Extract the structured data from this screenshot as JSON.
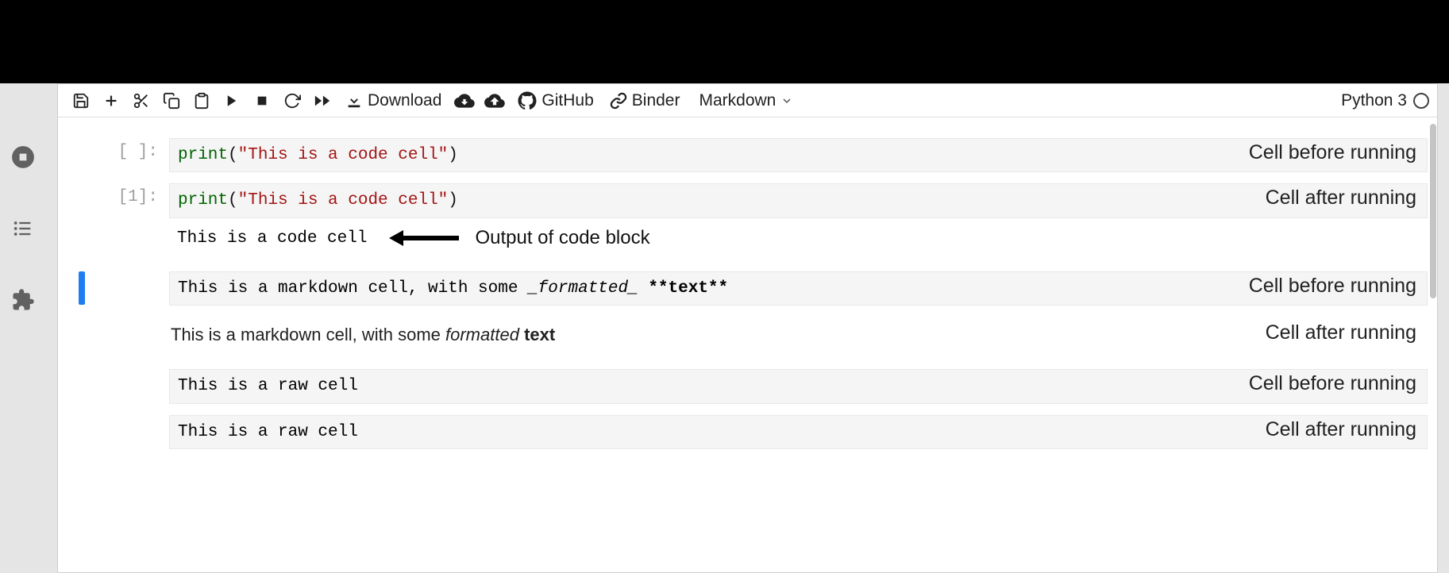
{
  "toolbar": {
    "download_label": "Download",
    "github_label": "GitHub",
    "binder_label": "Binder",
    "celltype_label": "Markdown"
  },
  "kernel": {
    "name": "Python 3"
  },
  "cells": {
    "c1": {
      "prompt": "[ ]:",
      "code_fn": "print",
      "code_open": "(",
      "code_str": "\"This is a code cell\"",
      "code_close": ")",
      "annotation": "Cell before running"
    },
    "c2": {
      "prompt": "[1]:",
      "code_fn": "print",
      "code_open": "(",
      "code_str": "\"This is a code cell\"",
      "code_close": ")",
      "annotation": "Cell after running",
      "output": "This is a code cell",
      "output_label": "Output of code block"
    },
    "c3": {
      "raw_pre": "This is a markdown cell, with some ",
      "raw_italic": "_formatted_",
      "raw_mid": " ",
      "raw_bold": "**text**",
      "annotation": "Cell before running"
    },
    "c4": {
      "rendered_pre": "This is a markdown cell, with some ",
      "rendered_italic": "formatted",
      "rendered_mid": " ",
      "rendered_bold": "text",
      "annotation": "Cell after running"
    },
    "c5": {
      "text": "This is a raw cell",
      "annotation": "Cell before running"
    },
    "c6": {
      "text": "This is a raw cell",
      "annotation": "Cell after running"
    }
  }
}
